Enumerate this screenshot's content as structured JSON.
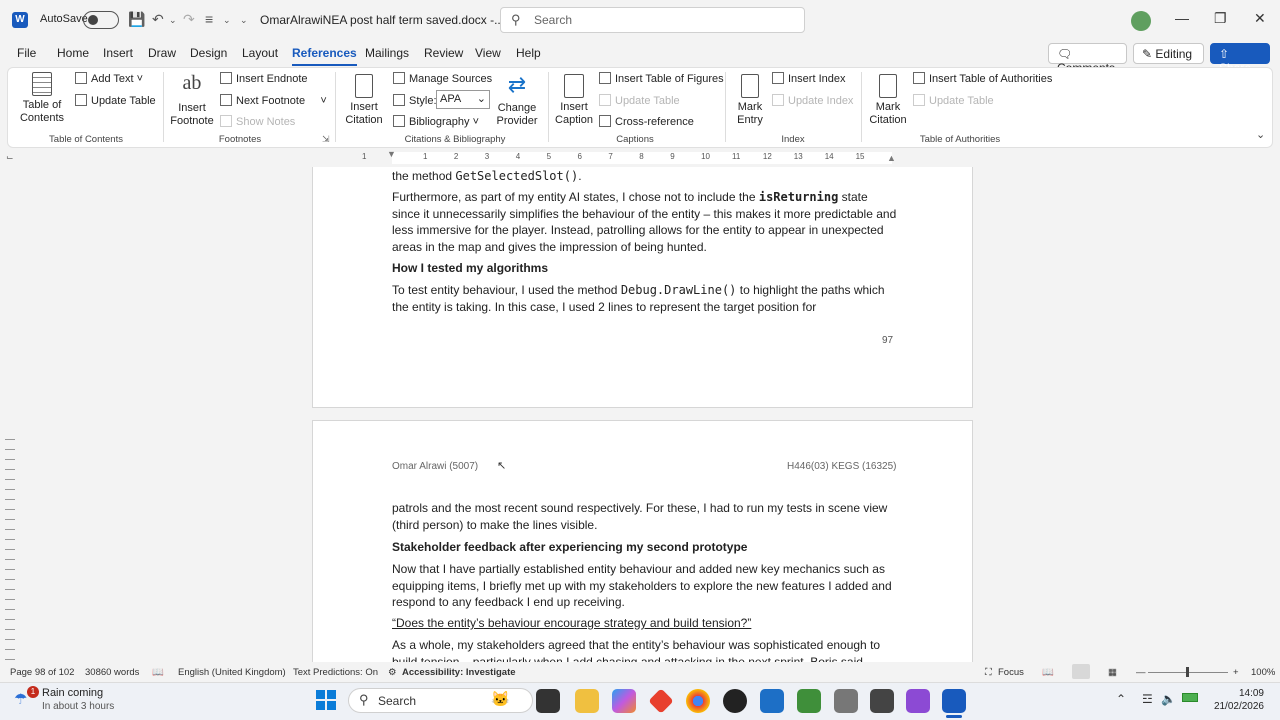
{
  "titlebar": {
    "app_initial": "W",
    "autosave": "AutoSave",
    "doc_title": "OmarAlrawiNEA post half term saved.docx  -...",
    "search_placeholder": "Search"
  },
  "menu": {
    "items": [
      "File",
      "Home",
      "Insert",
      "Draw",
      "Design",
      "Layout",
      "References",
      "Mailings",
      "Review",
      "View",
      "Help"
    ],
    "comments": "Comments",
    "editing": "Editing",
    "share": "Share"
  },
  "ribbon": {
    "toc": {
      "btn": "Table of Contents",
      "add_text": "Add Text",
      "update_table": "Update Table",
      "group": "Table of Contents"
    },
    "footnotes": {
      "insert_footnote": "Insert Footnote",
      "footnote_icon": "ab",
      "insert_endnote": "Insert Endnote",
      "next_footnote": "Next Footnote",
      "show_notes": "Show Notes",
      "group": "Footnotes"
    },
    "citations": {
      "insert_citation": "Insert Citation",
      "manage_sources": "Manage Sources",
      "style_label": "Style:",
      "style_value": "APA",
      "bibliography": "Bibliography",
      "change_provider": "Change Provider",
      "group": "Citations & Bibliography"
    },
    "captions": {
      "insert_caption": "Insert Caption",
      "insert_tof": "Insert Table of Figures",
      "update_table": "Update Table",
      "cross_reference": "Cross-reference",
      "group": "Captions"
    },
    "index": {
      "mark_entry": "Mark Entry",
      "insert_index": "Insert Index",
      "update_index": "Update Index",
      "group": "Index"
    },
    "toa": {
      "mark_citation": "Mark Citation",
      "insert_toa": "Insert Table of Authorities",
      "update_table": "Update Table",
      "group": "Table of Authorities"
    }
  },
  "ruler": {
    "numbers": [
      "1",
      "1",
      "2",
      "3",
      "4",
      "5",
      "6",
      "7",
      "8",
      "9",
      "10",
      "11",
      "12",
      "13",
      "14",
      "15"
    ]
  },
  "page1": {
    "line0_prefix": "the method ",
    "line0_code": "GetSelectedSlot()",
    "line0_suffix": ".",
    "p1_a": "Furthermore, as part of my entity AI states, I chose not to include the ",
    "p1_code": "isReturning",
    "p1_b": " state since it unnecessarily simplifies the behaviour of the entity – this makes it more predictable and less immersive for the player. Instead, patrolling allows for the entity to appear in unexpected areas in the map and gives the impression of being hunted.",
    "h1": "How I tested my algorithms",
    "p2_a": "To test entity behaviour, I used the method ",
    "p2_code": "Debug.DrawLine()",
    "p2_b": " to highlight the paths which the entity is taking. In this case, I used 2 lines to represent the target position for",
    "page_number": "97"
  },
  "page2": {
    "header_left": "Omar Alrawi (5007)",
    "header_right": "H446(03) KEGS (16325)",
    "p1": "patrols and the most recent sound respectively. For these, I had to run my tests in scene view (third person) to make the lines visible.",
    "h1": "Stakeholder feedback after experiencing my second prototype",
    "p2": "Now that I have partially established entity behaviour and added new key mechanics such as equipping items, I briefly met up with my stakeholders to explore the new features I added and respond to any feedback I end up receiving.",
    "quote": "“Does the entity’s behaviour encourage strategy and build tension?”",
    "p3": "As a whole, my stakeholders agreed that the entity’s behaviour was sophisticated enough to build tension – particularly when I add chasing and attacking in the next sprint. Boris said"
  },
  "status": {
    "page": "Page 98 of 102",
    "words": "30860 words",
    "language": "English (United Kingdom)",
    "predictions": "Text Predictions: On",
    "accessibility": "Accessibility: Investigate",
    "focus": "Focus",
    "zoom": "100%"
  },
  "taskbar": {
    "weather_title": "Rain coming",
    "weather_sub": "In about 3 hours",
    "weather_badge": "1",
    "search": "Search",
    "time": "14:09",
    "date": "21/02/2026"
  }
}
